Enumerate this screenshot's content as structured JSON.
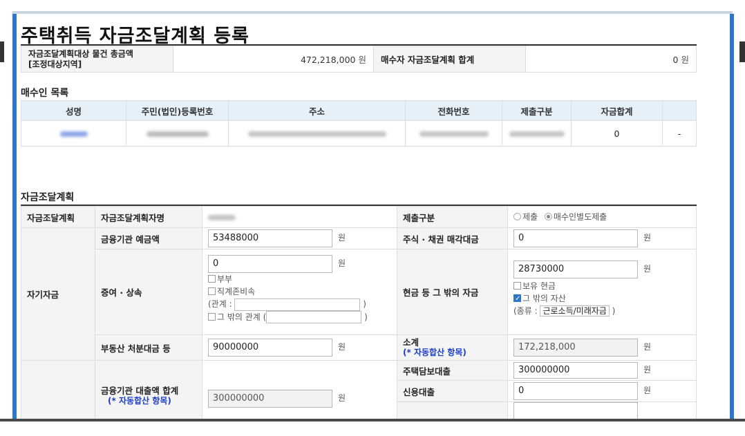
{
  "page_title": "주택취득 자금조달계획 등록",
  "summary": {
    "label1_line1": "자금조달계획대상 물건 총금액",
    "label1_line2": "[조정대상지역]",
    "value1": "472,218,000",
    "unit": "원",
    "label2": "매수자 자금조달계획 합계",
    "value2": "0"
  },
  "buyers": {
    "section_title": "매수인 목록",
    "headers": [
      "성명",
      "주민(법인)등록번호",
      "주소",
      "전화번호",
      "제출구분",
      "자금합계",
      ""
    ],
    "row": {
      "fund_total": "0",
      "action": "-"
    }
  },
  "plan": {
    "section_title": "자금조달계획",
    "row1": {
      "c1": "자금조달계획",
      "c2": "자금조달계획자명",
      "c4": "제출구분",
      "radio1": "제출",
      "radio2": "매수인별도제출"
    },
    "self_group": "자기자금",
    "deposit": {
      "label": "금융기관 예금액",
      "value": "53488000"
    },
    "stock": {
      "label": "주식 · 채권 매각대금",
      "value": "0"
    },
    "gift": {
      "label": "증여 · 상속",
      "value": "0",
      "chk1": "부부",
      "chk2": "직계존비속",
      "rel_label": "(관계 :",
      "rel_close": ")",
      "chk3": "그 밖의 관계 (",
      "chk3_close": ")"
    },
    "cash": {
      "label": "현금 등 그 밖의 자금",
      "value": "28730000",
      "chk1": "보유 현금",
      "chk2": "그 밖의 자산",
      "kind_label": "(종류 :",
      "kind_value": "근로소득/미래자금",
      "kind_close": ")"
    },
    "realestate": {
      "label": "부동산 처분대금 등",
      "value": "90000000"
    },
    "subtotal": {
      "label": "소계",
      "note": "(* 자동합산 항목)",
      "value": "172,218,000"
    },
    "mortgage": {
      "label": "주택담보대출",
      "value": "300000000"
    },
    "loan_total": {
      "label": "금융기관 대출액 합계",
      "note": "(* 자동합산 항목)",
      "value": "300000000"
    },
    "credit": {
      "label": "신용대출",
      "value": "0"
    },
    "won": "원"
  }
}
